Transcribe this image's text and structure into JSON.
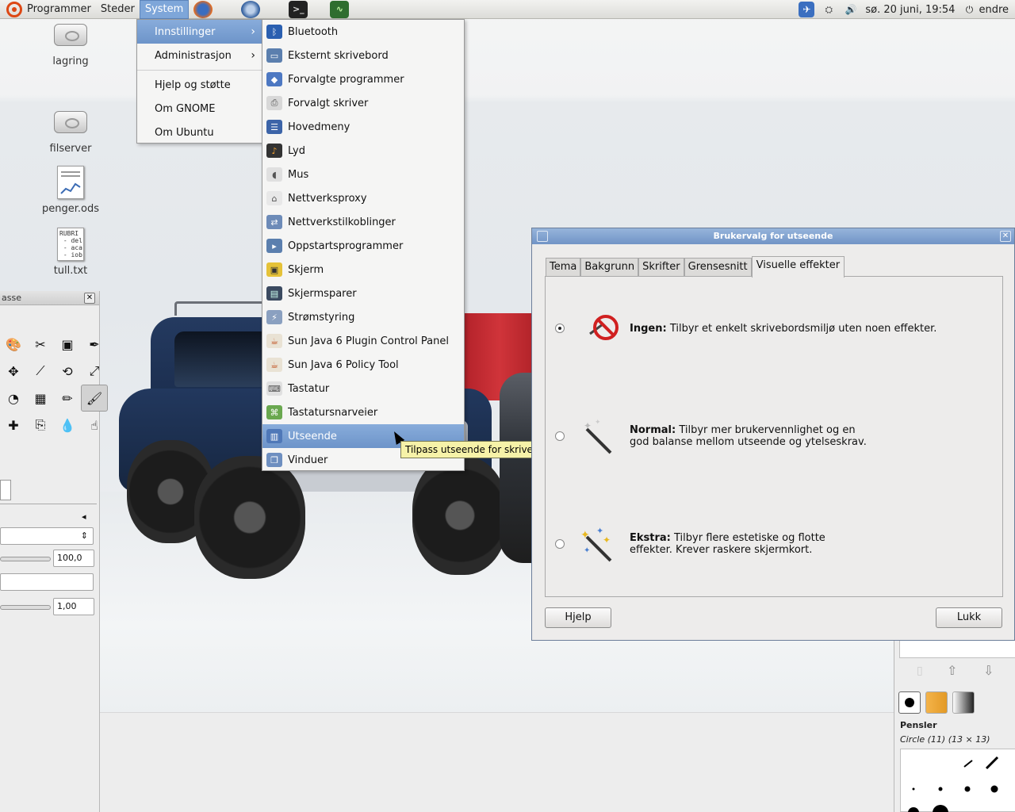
{
  "panel": {
    "menus": [
      "Programmer",
      "Steder",
      "System"
    ],
    "clock": "sø. 20 juni, 19:54",
    "user": "endre"
  },
  "desktop_icons": [
    {
      "label": "lagring",
      "icon": "drive-icon"
    },
    {
      "label": "filserver",
      "icon": "drive-icon"
    },
    {
      "label": "penger.ods",
      "icon": "spreadsheet-icon"
    },
    {
      "label": "tull.txt",
      "icon": "text-file-icon",
      "preview": "RUBRI\n - del\n - aca\n - iob"
    }
  ],
  "system_menu": {
    "items": [
      "Innstillinger",
      "Administrasjon",
      "Hjelp og støtte",
      "Om GNOME",
      "Om Ubuntu"
    ]
  },
  "preferences_menu": {
    "items": [
      {
        "label": "Bluetooth",
        "icon": "bluetooth-icon"
      },
      {
        "label": "Eksternt skrivebord",
        "icon": "remote-desktop-icon"
      },
      {
        "label": "Forvalgte programmer",
        "icon": "default-apps-icon"
      },
      {
        "label": "Forvalgt skriver",
        "icon": "printer-icon"
      },
      {
        "label": "Hovedmeny",
        "icon": "main-menu-icon"
      },
      {
        "label": "Lyd",
        "icon": "sound-icon"
      },
      {
        "label": "Mus",
        "icon": "mouse-icon"
      },
      {
        "label": "Nettverksproxy",
        "icon": "network-proxy-icon"
      },
      {
        "label": "Nettverkstilkoblinger",
        "icon": "network-connections-icon"
      },
      {
        "label": "Oppstartsprogrammer",
        "icon": "startup-apps-icon"
      },
      {
        "label": "Skjerm",
        "icon": "display-icon"
      },
      {
        "label": "Skjermsparer",
        "icon": "screensaver-icon"
      },
      {
        "label": "Strømstyring",
        "icon": "power-icon"
      },
      {
        "label": "Sun Java 6 Plugin Control Panel",
        "icon": "java-icon"
      },
      {
        "label": "Sun Java 6 Policy Tool",
        "icon": "java-icon"
      },
      {
        "label": "Tastatur",
        "icon": "keyboard-icon"
      },
      {
        "label": "Tastatursnarveier",
        "icon": "keyboard-shortcuts-icon"
      },
      {
        "label": "Utseende",
        "icon": "appearance-icon"
      },
      {
        "label": "Vinduer",
        "icon": "windows-icon"
      }
    ],
    "highlighted": "Utseende"
  },
  "tooltip": "Tilpass utseende for skrivebordet",
  "gimp_toolbox": {
    "title": "asse",
    "opacity": "100,0",
    "scale": "1,00"
  },
  "gimp_dock": {
    "brushes_title": "Pensler",
    "brush_name": "Circle (11) (13 × 13)"
  },
  "dialog": {
    "title": "Brukervalg for utseende",
    "tabs": [
      "Tema",
      "Bakgrunn",
      "Skrifter",
      "Grensesnitt",
      "Visuelle effekter"
    ],
    "active_tab": "Visuelle effekter",
    "options": [
      {
        "name": "Ingen:",
        "desc": "Tilbyr et enkelt skrivebordsmiljø uten noen effekter.",
        "desc2": "",
        "selected": true
      },
      {
        "name": "Normal:",
        "desc": "Tilbyr mer brukervennlighet og en",
        "desc2": "god balanse mellom utseende og ytelseskrav.",
        "selected": false
      },
      {
        "name": "Ekstra:",
        "desc": "Tilbyr flere estetiske og flotte",
        "desc2": "effekter. Krever raskere skjermkort.",
        "selected": false
      }
    ],
    "help_button": "Hjelp",
    "close_button": "Lukk"
  }
}
